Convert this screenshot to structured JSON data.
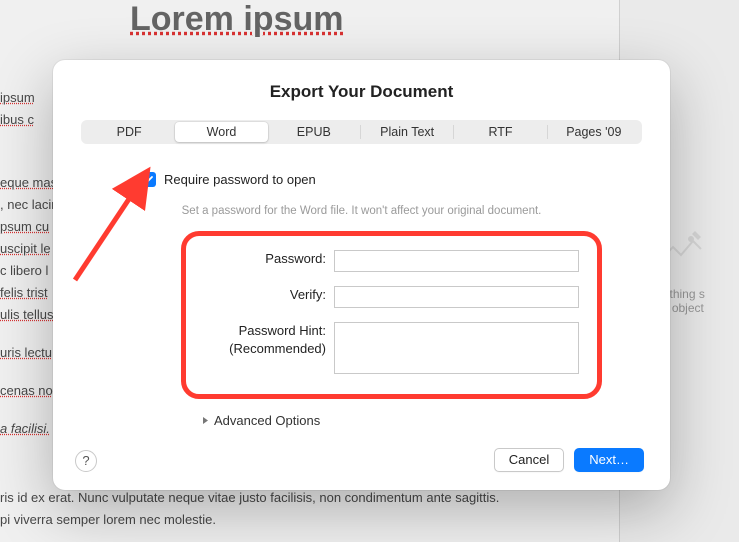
{
  "background": {
    "title": "Lorem ipsum",
    "lines": [
      "ipsum",
      "ibus c",
      "eque mas",
      ", nec lacin",
      "psum cu",
      "uscipit le",
      "c libero l",
      "felis trist",
      "ulis tellus",
      "uris lectu",
      "cenas no",
      "a facilisi.",
      "ris id ex erat. Nunc vulputate neque vitae justo facilisis, non condimentum ante sagittis.",
      "pi viverra semper lorem nec molestie."
    ],
    "right_panel_line1": "Nothing s",
    "right_panel_line2": "an object"
  },
  "modal": {
    "title": "Export Your Document",
    "tabs": [
      "PDF",
      "Word",
      "EPUB",
      "Plain Text",
      "RTF",
      "Pages '09"
    ],
    "active_tab": "Word",
    "require_password_label": "Require password to open",
    "hint": "Set a password for the Word file. It won't affect your original document.",
    "fields": {
      "password_label": "Password:",
      "verify_label": "Verify:",
      "hint_label_line1": "Password Hint:",
      "hint_label_line2": "(Recommended)"
    },
    "advanced_label": "Advanced Options",
    "help": "?",
    "cancel": "Cancel",
    "next": "Next…"
  }
}
